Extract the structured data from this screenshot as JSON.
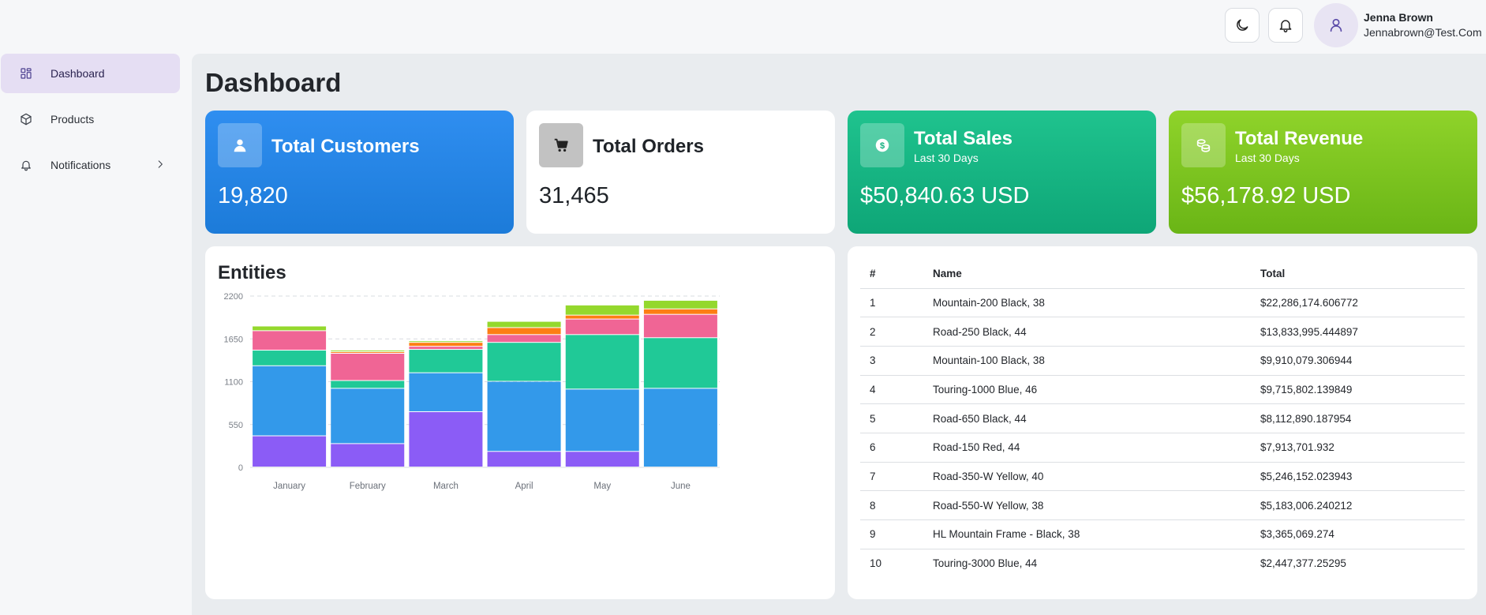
{
  "header": {
    "user_name": "Jenna Brown",
    "user_email": "Jennabrown@Test.Com",
    "icons": [
      "moon-icon",
      "bell-icon",
      "user-icon"
    ]
  },
  "sidebar": {
    "items": [
      {
        "label": "Dashboard",
        "icon": "grid-icon",
        "active": true
      },
      {
        "label": "Products",
        "icon": "box-icon",
        "active": false
      },
      {
        "label": "Notifications",
        "icon": "bell-icon",
        "active": false,
        "expandable": true
      }
    ]
  },
  "page": {
    "title": "Dashboard"
  },
  "cards": [
    {
      "title": "Total Customers",
      "subtitle": "",
      "value": "19,820",
      "icon": "user-icon",
      "color": "#2f8ef0"
    },
    {
      "title": "Total Orders",
      "subtitle": "",
      "value": "31,465",
      "icon": "cart-icon",
      "color": "#ffffff"
    },
    {
      "title": "Total Sales",
      "subtitle": "Last 30 Days",
      "value": "$50,840.63 USD",
      "icon": "dollar-icon",
      "color": "#1fc38e"
    },
    {
      "title": "Total Revenue",
      "subtitle": "Last 30 Days",
      "value": "$56,178.92 USD",
      "icon": "coins-icon",
      "color": "#8fd32a"
    }
  ],
  "chart_data": {
    "type": "bar",
    "stacked": true,
    "title": "Entities",
    "categories": [
      "January",
      "February",
      "March",
      "April",
      "May",
      "June"
    ],
    "ylim": [
      0,
      2200
    ],
    "yticks": [
      0,
      550,
      1100,
      1650,
      2200
    ],
    "grid": true,
    "series": [
      {
        "color": "#8b5cf6",
        "values": [
          400,
          300,
          710,
          200,
          200,
          0
        ]
      },
      {
        "color": "#3399ea",
        "values": [
          900,
          710,
          500,
          900,
          800,
          1010
        ]
      },
      {
        "color": "#20c997",
        "values": [
          200,
          100,
          300,
          500,
          700,
          650
        ]
      },
      {
        "color": "#f06595",
        "values": [
          250,
          350,
          40,
          100,
          200,
          300
        ]
      },
      {
        "color": "#fd7e14",
        "values": [
          0,
          20,
          50,
          90,
          50,
          70
        ]
      },
      {
        "color": "#94d82d",
        "values": [
          60,
          20,
          20,
          80,
          130,
          110
        ]
      }
    ]
  },
  "table": {
    "headers": [
      "#",
      "Name",
      "Total"
    ],
    "rows": [
      [
        "1",
        "Mountain-200 Black, 38",
        "$22,286,174.606772"
      ],
      [
        "2",
        "Road-250 Black, 44",
        "$13,833,995.444897"
      ],
      [
        "3",
        "Mountain-100 Black, 38",
        "$9,910,079.306944"
      ],
      [
        "4",
        "Touring-1000 Blue, 46",
        "$9,715,802.139849"
      ],
      [
        "5",
        "Road-650 Black, 44",
        "$8,112,890.187954"
      ],
      [
        "6",
        "Road-150 Red, 44",
        "$7,913,701.932"
      ],
      [
        "7",
        "Road-350-W Yellow, 40",
        "$5,246,152.023943"
      ],
      [
        "8",
        "Road-550-W Yellow, 38",
        "$5,183,006.240212"
      ],
      [
        "9",
        "HL Mountain Frame - Black, 38",
        "$3,365,069.274"
      ],
      [
        "10",
        "Touring-3000 Blue, 44",
        "$2,447,377.25295"
      ]
    ]
  }
}
